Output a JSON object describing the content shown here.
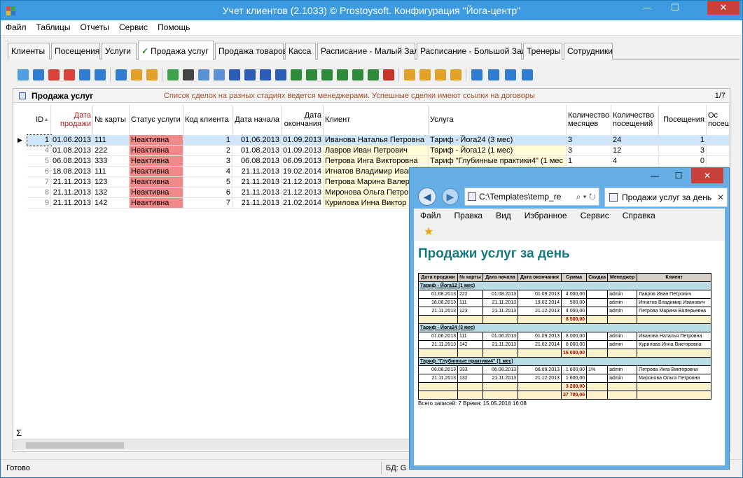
{
  "window": {
    "title": "Учет клиентов (2.1033) © Prostoysoft. Конфигурация \"Йога-центр\"",
    "min": "—",
    "max": "☐",
    "close": "✕"
  },
  "menu": [
    "Файл",
    "Таблицы",
    "Отчеты",
    "Сервис",
    "Помощь"
  ],
  "tabs": [
    "Клиенты",
    "Посещения",
    "Услуги",
    "Продажа услуг",
    "Продажа товаров",
    "Касса",
    "Расписание - Малый Зал",
    "Расписание - Большой Зал",
    "Тренеры",
    "Сотрудники"
  ],
  "active_tab_check": "✓",
  "panel": {
    "title": "Продажа услуг",
    "description": "Список сделок на разных стадиях ведется менеджерами. Успешные сделки имеют ссылки на договоры",
    "counter": "1/7"
  },
  "grid": {
    "columns": [
      "ID",
      "Дата продажи",
      "№ карты",
      "Статус услуги",
      "Код клиента",
      "Дата начала",
      "Дата окончания",
      "Клиент",
      "Услуга",
      "Количество месяцев",
      "Количество посещений",
      "Посещения",
      "Ос посеш"
    ],
    "sort_indicator": "▲",
    "rows": [
      {
        "id": "1",
        "sale": "01.06.2013",
        "card": "111",
        "status": "Неактивна",
        "code": "1",
        "start": "01.06.2013",
        "end": "01.09.2013",
        "client": "Иванова Наталья Петровна",
        "service": "Тариф - Йога24 (3 мес)",
        "months": "3",
        "qty": "24",
        "visits": "1"
      },
      {
        "id": "4",
        "sale": "01.08.2013",
        "card": "222",
        "status": "Неактивна",
        "code": "2",
        "start": "01.08.2013",
        "end": "01.09.2013",
        "client": "Лавров Иван Петрович",
        "service": "Тариф - Йога12 (1 мес)",
        "months": "3",
        "qty": "12",
        "visits": "3"
      },
      {
        "id": "5",
        "sale": "06.08.2013",
        "card": "333",
        "status": "Неактивна",
        "code": "3",
        "start": "06.08.2013",
        "end": "06.09.2013",
        "client": "Петрова Инга Викторовна",
        "service": "Тариф \"Глубинные практики4\" (1 мес",
        "months": "1",
        "qty": "4",
        "visits": "0"
      },
      {
        "id": "6",
        "sale": "18.08.2013",
        "card": "111",
        "status": "Неактивна",
        "code": "4",
        "start": "21.11.2013",
        "end": "19.02.2014",
        "client": "Игнатов Владимир Иван",
        "service": "",
        "months": "",
        "qty": "",
        "visits": ""
      },
      {
        "id": "7",
        "sale": "21.11.2013",
        "card": "123",
        "status": "Неактивна",
        "code": "5",
        "start": "21.11.2013",
        "end": "21.12.2013",
        "client": "Петрова Марина Валер",
        "service": "",
        "months": "",
        "qty": "",
        "visits": ""
      },
      {
        "id": "8",
        "sale": "21.11.2013",
        "card": "132",
        "status": "Неактивна",
        "code": "6",
        "start": "21.11.2013",
        "end": "21.12.2013",
        "client": "Миронова Ольга Петров",
        "service": "",
        "months": "",
        "qty": "",
        "visits": ""
      },
      {
        "id": "9",
        "sale": "21.11.2013",
        "card": "142",
        "status": "Неактивна",
        "code": "7",
        "start": "21.11.2013",
        "end": "21.02.2014",
        "client": "Курилова Инна Виктор",
        "service": "",
        "months": "",
        "qty": "",
        "visits": ""
      }
    ],
    "sigma": "Σ",
    "row_pointer": "▶"
  },
  "status": {
    "left": "Готово",
    "db": "БД:",
    "db_val": "G"
  },
  "ie": {
    "address": "C:\\Templates\\temp_re",
    "addr_controls": "⌕ ▾ ↻",
    "tab_title": "Продажи услуг за день",
    "tab_close": "✕",
    "back": "◀",
    "fwd": "▶",
    "menu": [
      "Файл",
      "Правка",
      "Вид",
      "Избранное",
      "Сервис",
      "Справка"
    ],
    "fav_icon": "★",
    "report_title": "Продажи услуг за день",
    "report_headers": [
      "Дата продажи",
      "№ карты",
      "Дата начала",
      "Дата окончания",
      "Сумма",
      "Скидка",
      "Менеджер",
      "Клиент"
    ],
    "groups": [
      {
        "name": "Тариф - Йога12 (1 мес)",
        "rows": [
          [
            "01.08.2013",
            "222",
            "01.08.2013",
            "01.09.2013",
            "4 000,00",
            "",
            "admin",
            "Лавров Иван Петрович"
          ],
          [
            "18.08.2013",
            "111",
            "21.11.2013",
            "19.02.2014",
            "500,00",
            "",
            "admin",
            "Игнатов Владимир Иванович"
          ],
          [
            "21.11.2013",
            "123",
            "21.11.2013",
            "21.12.2013",
            "4 000,00",
            "",
            "admin",
            "Петрова Марина Валерьевна"
          ]
        ],
        "subtotal": "8 500,00"
      },
      {
        "name": "Тариф - Йога24 (3 мес)",
        "rows": [
          [
            "01.06.2013",
            "111",
            "01.06.2013",
            "01.09.2013",
            "8 000,00",
            "",
            "admin",
            "Иванова Наталья Петровна"
          ],
          [
            "21.11.2013",
            "142",
            "21.11.2013",
            "21.02.2014",
            "8 000,00",
            "",
            "admin",
            "Курилова Инна Викторовна"
          ]
        ],
        "subtotal": "16 000,00"
      },
      {
        "name": "Тариф \"Глубинные практики4\" (1 мес)",
        "rows": [
          [
            "06.08.2013",
            "333",
            "06.08.2013",
            "06.09.2013",
            "1 600,00",
            "1%",
            "admin",
            "Петрова Инга Викторовна"
          ],
          [
            "21.11.2013",
            "132",
            "21.11.2013",
            "21.12.2013",
            "1 600,00",
            "",
            "admin",
            "Миронова Ольга Петровна"
          ]
        ],
        "subtotal": "3 200,00"
      }
    ],
    "total": "27 700,00",
    "footer": "Всего записей: 7    Время: 15.05.2018 16:08"
  }
}
